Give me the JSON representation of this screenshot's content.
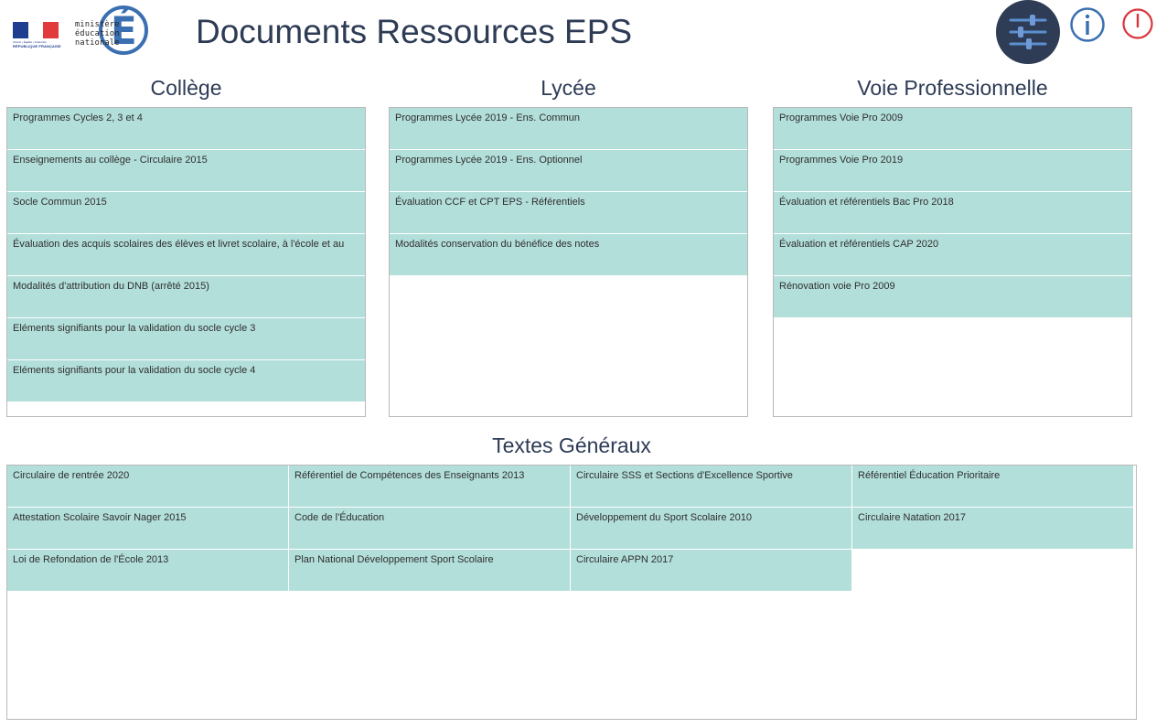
{
  "header": {
    "flag_motto": "Liberté • Égalité • Fraternité",
    "flag_caption": "RÉPUBLIQUE FRANÇAISE",
    "ministry_lines": [
      "ministère",
      "éducation",
      "nationale"
    ],
    "ministry_letter": "É",
    "title": "Documents Ressources EPS",
    "buttons": {
      "settings": "settings-sliders-icon",
      "info": "info-icon",
      "power": "power-icon"
    }
  },
  "colors": {
    "item_bg": "#b3dfdb",
    "title": "#2d3b55",
    "settings_bg": "#2e3d55",
    "info": "#3a6fb1",
    "power": "#d9363e"
  },
  "college": {
    "title": "Collège",
    "items": [
      "Programmes Cycles 2, 3 et 4",
      "Enseignements au collège - Circulaire 2015",
      "Socle Commun 2015",
      "Évaluation des acquis scolaires des élèves et livret scolaire, à l'école et au",
      "Modalités d'attribution du DNB (arrêté 2015)",
      "Eléments signifiants pour la validation du socle cycle 3",
      "Eléments signifiants pour la validation du socle cycle 4"
    ]
  },
  "lycee": {
    "title": "Lycée",
    "items": [
      "Programmes Lycée 2019 - Ens. Commun",
      "Programmes Lycée 2019 - Ens. Optionnel",
      "Évaluation CCF et CPT EPS - Référentiels",
      "Modalités conservation du bénéfice des notes"
    ]
  },
  "voie_pro": {
    "title": "Voie Professionnelle",
    "items": [
      "Programmes Voie Pro 2009",
      "Programmes Voie Pro 2019",
      "Évaluation et référentiels Bac Pro 2018",
      "Évaluation et référentiels CAP 2020",
      "Rénovation voie Pro 2009"
    ]
  },
  "textes_generaux": {
    "title": "Textes Généraux",
    "items": [
      "Circulaire de rentrée 2020",
      "Référentiel de Compétences des Enseignants 2013",
      "Circulaire SSS et Sections d'Excellence Sportive",
      "Référentiel Éducation Prioritaire",
      "Attestation Scolaire Savoir Nager 2015",
      "Code de l'Éducation",
      "Développement du Sport Scolaire 2010",
      "Circulaire Natation 2017",
      "Loi de Refondation de l'École 2013",
      "Plan National Développement Sport Scolaire",
      "Circulaire APPN 2017"
    ]
  }
}
